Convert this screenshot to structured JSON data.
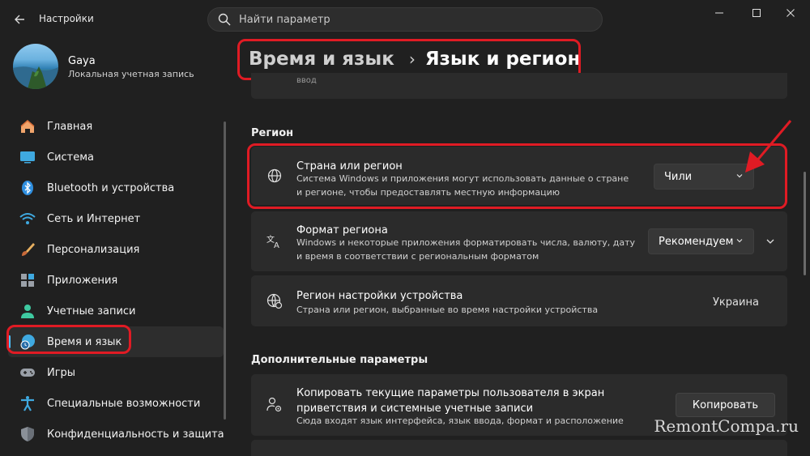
{
  "window": {
    "title": "Настройки",
    "search_placeholder": "Найти параметр"
  },
  "profile": {
    "name": "Gaya",
    "account_type": "Локальная учетная запись"
  },
  "nav": [
    {
      "label": "Главная",
      "icon": "home-icon"
    },
    {
      "label": "Система",
      "icon": "system-icon"
    },
    {
      "label": "Bluetooth и устройства",
      "icon": "bluetooth-icon"
    },
    {
      "label": "Сеть и Интернет",
      "icon": "wifi-icon"
    },
    {
      "label": "Персонализация",
      "icon": "brush-icon"
    },
    {
      "label": "Приложения",
      "icon": "apps-icon"
    },
    {
      "label": "Учетные записи",
      "icon": "person-icon"
    },
    {
      "label": "Время и язык",
      "icon": "time-language-icon",
      "active": true
    },
    {
      "label": "Игры",
      "icon": "gamepad-icon"
    },
    {
      "label": "Специальные возможности",
      "icon": "accessibility-icon"
    },
    {
      "label": "Конфиденциальность и защита",
      "icon": "shield-icon"
    }
  ],
  "breadcrumb": {
    "parent": "Время и язык",
    "separator": "›",
    "current": "Язык и регион"
  },
  "top_card_text": "ввод",
  "region_section": {
    "title": "Регион",
    "country": {
      "title": "Страна или регион",
      "description": "Система Windows и приложения могут использовать данные о стране и регионе, чтобы предоставлять местную информацию",
      "value": "Чили"
    },
    "format": {
      "title": "Формат региона",
      "description": "Windows и некоторые приложения форматировать числа, валюту, дату и время в соответствии с региональным форматом",
      "value": "Рекомендуем"
    },
    "device_region": {
      "title": "Регион настройки устройства",
      "description": "Страна или регион, выбранные во время настройки устройства",
      "value": "Украина"
    }
  },
  "additional_section": {
    "title": "Дополнительные параметры",
    "copy": {
      "title": "Копировать текущие параметры пользователя в экран приветствия и системные учетные записи",
      "description": "Сюда входят язык интерфейса, язык ввода, формат и расположение",
      "button": "Копировать"
    }
  },
  "watermark": "RemontCompa.ru",
  "colors": {
    "accent": "#4cc2ff",
    "highlight": "#e01b24",
    "background": "#202020",
    "card": "#2b2b2b"
  }
}
